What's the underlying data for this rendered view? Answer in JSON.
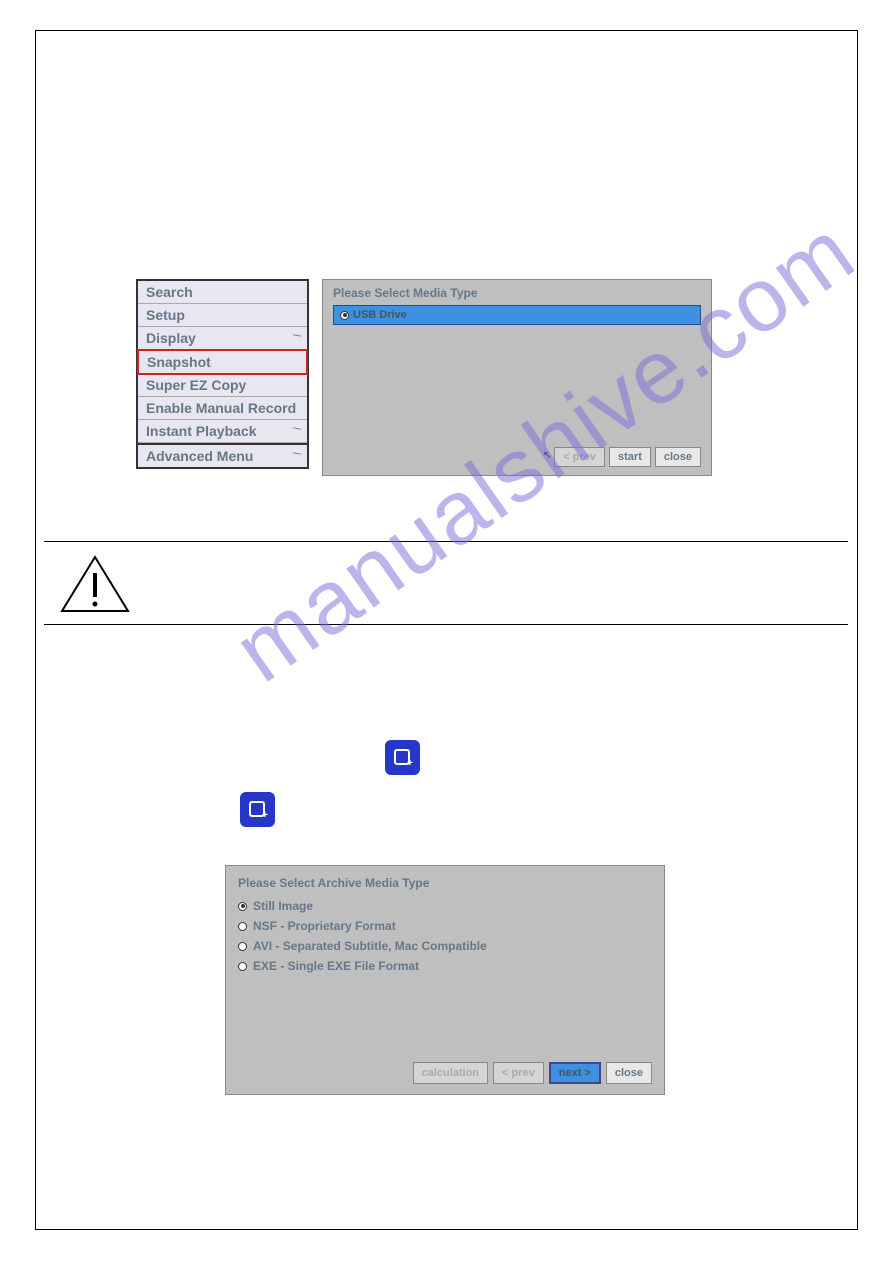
{
  "watermark": "manualshive.com",
  "context_menu": {
    "items": [
      {
        "label": "Search",
        "submenu": false,
        "highlighted": false
      },
      {
        "label": "Setup",
        "submenu": false,
        "highlighted": false
      },
      {
        "label": "Display",
        "submenu": true,
        "highlighted": false
      },
      {
        "label": "Snapshot",
        "submenu": true,
        "highlighted": true
      },
      {
        "label": "Super EZ Copy",
        "submenu": false,
        "highlighted": false
      },
      {
        "label": "Enable Manual Record",
        "submenu": false,
        "highlighted": false
      },
      {
        "label": "Instant Playback",
        "submenu": true,
        "highlighted": false
      },
      {
        "label": "Advanced Menu",
        "submenu": true,
        "highlighted": false
      }
    ]
  },
  "media_dialog": {
    "title": "Please Select Media Type",
    "option": "USB Drive",
    "buttons": {
      "prev": "< prev",
      "start": "start",
      "close": "close"
    }
  },
  "archive_dialog": {
    "title": "Please Select Archive Media Type",
    "options": [
      {
        "label": "Still Image",
        "selected": true
      },
      {
        "label": "NSF - Proprietary Format",
        "selected": false
      },
      {
        "label": "AVI - Separated Subtitle, Mac Compatible",
        "selected": false
      },
      {
        "label": "EXE - Single EXE File Format",
        "selected": false
      }
    ],
    "buttons": {
      "calculation": "calculation",
      "prev": "< prev",
      "next": "next >",
      "close": "close"
    }
  }
}
